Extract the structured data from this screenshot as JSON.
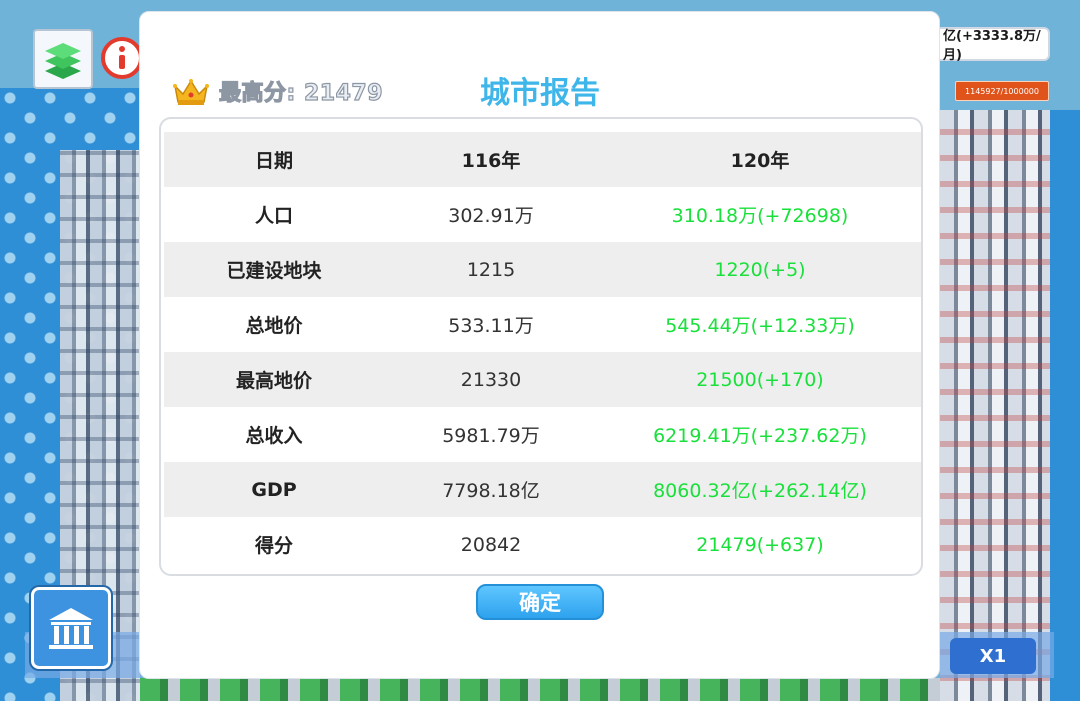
{
  "hud": {
    "money_text": "亿(+3333.8万/月)",
    "progress_text": "1145927/1000000",
    "speed_label": "X1",
    "layers_icon": "layers-icon",
    "info_icon": "info-icon",
    "bank_icon": "bank-icon",
    "colors": {
      "info": "#e23b2e",
      "progress": "#e0531b",
      "accent": "#3fb6ea"
    }
  },
  "report": {
    "title": "城市报告",
    "best_score": "最高分: 21479",
    "crown_icon": "crown-icon",
    "header": {
      "label": "日期",
      "prev": "116年",
      "curr": "120年"
    },
    "rows": [
      {
        "label": "人口",
        "prev": "302.91万",
        "curr": "310.18万(+72698)"
      },
      {
        "label": "已建设地块",
        "prev": "1215",
        "curr": "1220(+5)"
      },
      {
        "label": "总地价",
        "prev": "533.11万",
        "curr": "545.44万(+12.33万)"
      },
      {
        "label": "最高地价",
        "prev": "21330",
        "curr": "21500(+170)"
      },
      {
        "label": "总收入",
        "prev": "5981.79万",
        "curr": "6219.41万(+237.62万)"
      },
      {
        "label": "GDP",
        "prev": "7798.18亿",
        "curr": "8060.32亿(+262.14亿)"
      },
      {
        "label": "得分",
        "prev": "20842",
        "curr": "21479(+637)"
      }
    ],
    "confirm_label": "确定",
    "colors": {
      "increase": "#19e03a",
      "row_shade": "#eeeeee"
    }
  }
}
